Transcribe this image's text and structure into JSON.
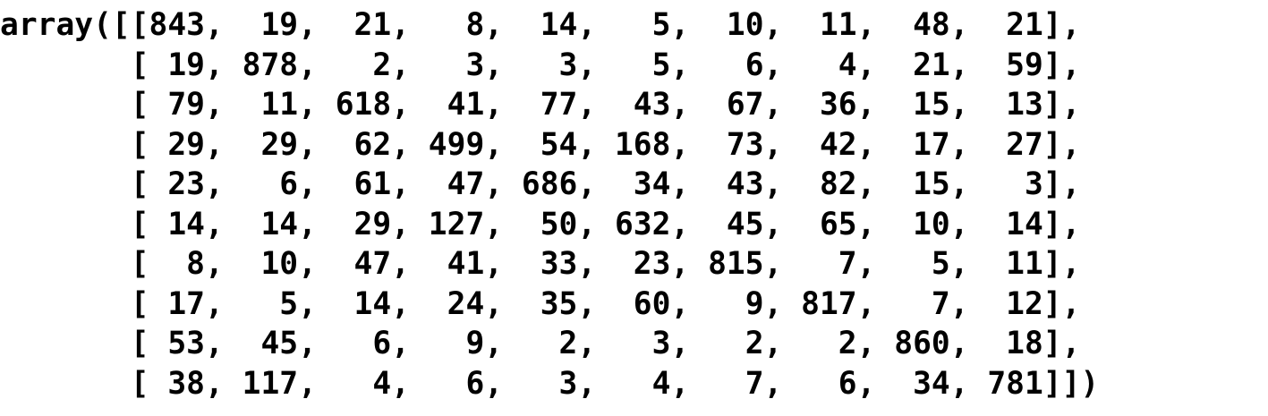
{
  "output": {
    "lines": [
      "array([[843,  19,  21,   8,  14,   5,  10,  11,  48,  21],",
      "       [ 19, 878,   2,   3,   3,   5,   6,   4,  21,  59],",
      "       [ 79,  11, 618,  41,  77,  43,  67,  36,  15,  13],",
      "       [ 29,  29,  62, 499,  54, 168,  73,  42,  17,  27],",
      "       [ 23,   6,  61,  47, 686,  34,  43,  82,  15,   3],",
      "       [ 14,  14,  29, 127,  50, 632,  45,  65,  10,  14],",
      "       [  8,  10,  47,  41,  33,  23, 815,   7,   5,  11],",
      "       [ 17,   5,  14,  24,  35,  60,   9, 817,   7,  12],",
      "       [ 53,  45,   6,   9,   2,   3,   2,   2, 860,  18],",
      "       [ 38, 117,   4,   6,   3,   4,   7,   6,  34, 781]])"
    ]
  }
}
